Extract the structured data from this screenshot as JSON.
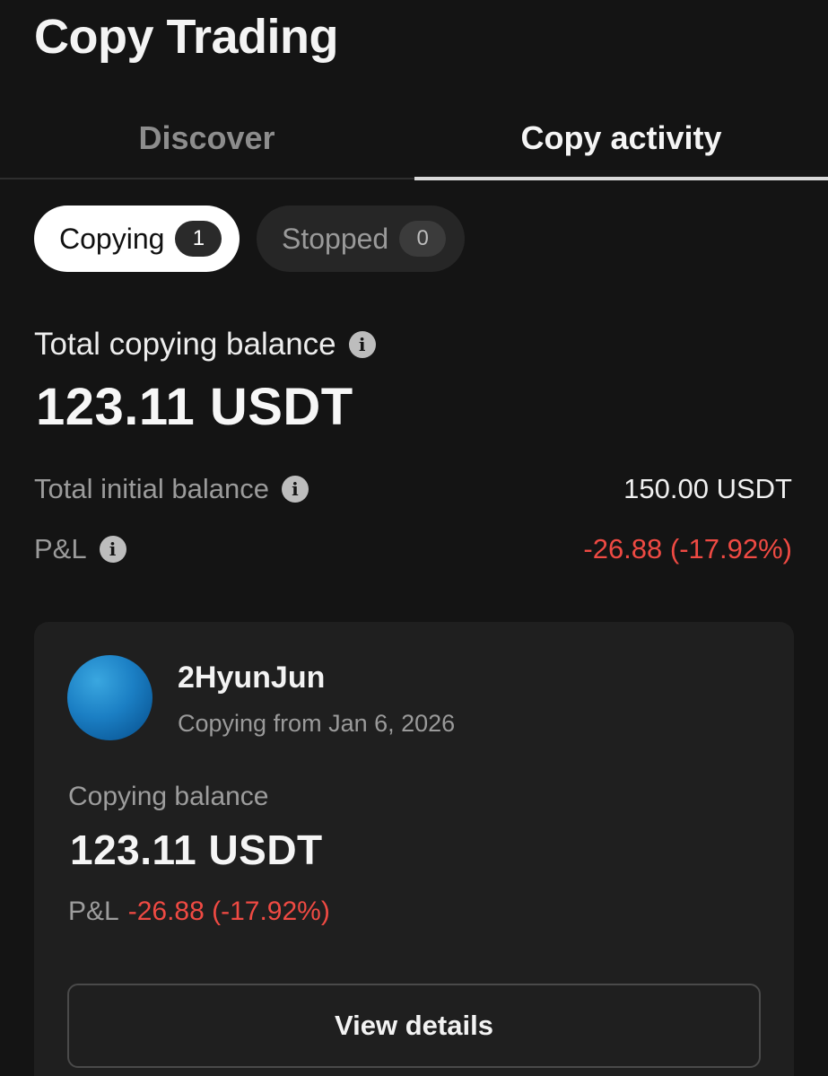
{
  "header": {
    "title": "Copy Trading"
  },
  "tabs": [
    {
      "label": "Discover",
      "active": false
    },
    {
      "label": "Copy activity",
      "active": true
    }
  ],
  "filters": {
    "copying": {
      "label": "Copying",
      "count": "1",
      "active": true
    },
    "stopped": {
      "label": "Stopped",
      "count": "0",
      "active": false
    }
  },
  "summary": {
    "total_label": "Total copying balance",
    "total_value": "123.11 USDT",
    "initial_label": "Total initial balance",
    "initial_value": "150.00 USDT",
    "pnl_label": "P&L",
    "pnl_value": "-26.88 (-17.92%)",
    "info_icon_glyph": "i"
  },
  "card": {
    "trader_name": "2HyunJun",
    "copying_since": "Copying from Jan 6, 2026",
    "balance_label": "Copying balance",
    "balance_value": "123.11 USDT",
    "pnl_label": "P&L",
    "pnl_value": "-26.88 (-17.92%)",
    "button_label": "View details"
  },
  "colors": {
    "background": "#141414",
    "card": "#1f1f1f",
    "negative": "#ef4a43",
    "avatar": "#1b7fc4"
  }
}
